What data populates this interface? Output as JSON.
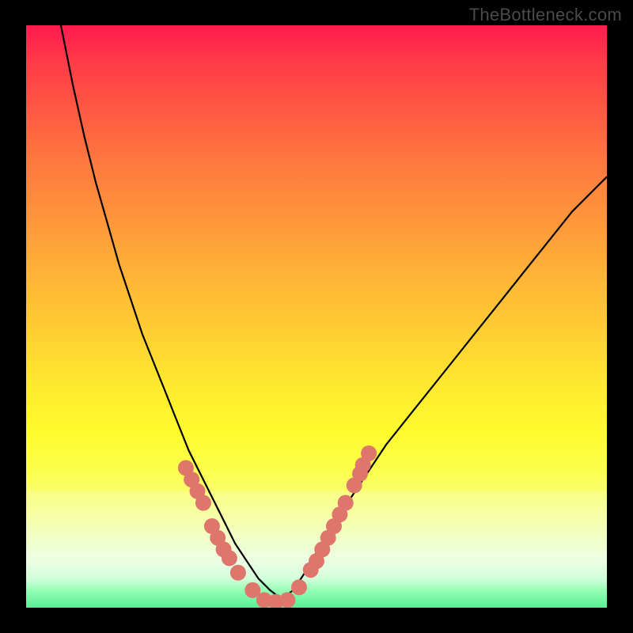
{
  "watermark": "TheBottleneck.com",
  "chart_data": {
    "type": "line",
    "title": "",
    "xlabel": "",
    "ylabel": "",
    "xlim": [
      0,
      100
    ],
    "ylim": [
      0,
      100
    ],
    "grid": false,
    "series": [
      {
        "name": "bottleneck-curve",
        "color": "#000000",
        "x": [
          6,
          8,
          10,
          12,
          14,
          16,
          18,
          20,
          22,
          24,
          26,
          28,
          30,
          32,
          34,
          36,
          38,
          40,
          42,
          44,
          46,
          48,
          50,
          54,
          58,
          62,
          66,
          70,
          74,
          78,
          82,
          86,
          90,
          94,
          98,
          100
        ],
        "y": [
          100,
          90,
          81,
          73,
          66,
          59,
          53,
          47,
          42,
          37,
          32,
          27,
          23,
          19,
          15,
          11,
          8,
          5,
          3,
          1.5,
          3,
          6,
          9.5,
          16,
          22,
          28,
          33,
          38,
          43,
          48,
          53,
          58,
          63,
          68,
          72,
          74
        ]
      },
      {
        "name": "acceptable-band-upper",
        "color": "#ffffff",
        "opacity": 0.45,
        "x": [
          0,
          100
        ],
        "y": [
          20,
          20
        ]
      },
      {
        "name": "acceptable-band-lower",
        "color": "#ffffff",
        "opacity": 0.55,
        "x": [
          0,
          100
        ],
        "y": [
          10,
          10
        ]
      }
    ],
    "markers": [
      {
        "name": "left-arm-dots",
        "color": "#df766e",
        "points": [
          {
            "x": 27.5,
            "y": 24.0
          },
          {
            "x": 28.5,
            "y": 22.0
          },
          {
            "x": 29.5,
            "y": 20.0
          },
          {
            "x": 30.5,
            "y": 18.0
          },
          {
            "x": 32.0,
            "y": 14.0
          },
          {
            "x": 33.0,
            "y": 12.0
          },
          {
            "x": 34.0,
            "y": 10.0
          },
          {
            "x": 35.0,
            "y": 8.5
          },
          {
            "x": 36.5,
            "y": 6.0
          },
          {
            "x": 39.0,
            "y": 3.0
          }
        ]
      },
      {
        "name": "bottom-dots",
        "color": "#df766e",
        "points": [
          {
            "x": 41.0,
            "y": 1.3
          },
          {
            "x": 43.0,
            "y": 1.0
          },
          {
            "x": 45.0,
            "y": 1.3
          }
        ]
      },
      {
        "name": "right-arm-dots",
        "color": "#df766e",
        "points": [
          {
            "x": 47.0,
            "y": 3.5
          },
          {
            "x": 49.0,
            "y": 6.5
          },
          {
            "x": 50.0,
            "y": 8.0
          },
          {
            "x": 51.0,
            "y": 10.0
          },
          {
            "x": 52.0,
            "y": 12.0
          },
          {
            "x": 53.0,
            "y": 14.0
          },
          {
            "x": 54.0,
            "y": 16.0
          },
          {
            "x": 55.0,
            "y": 18.0
          },
          {
            "x": 56.5,
            "y": 21.0
          },
          {
            "x": 57.5,
            "y": 23.0
          },
          {
            "x": 58.0,
            "y": 24.5
          },
          {
            "x": 59.0,
            "y": 26.5
          }
        ]
      }
    ]
  }
}
